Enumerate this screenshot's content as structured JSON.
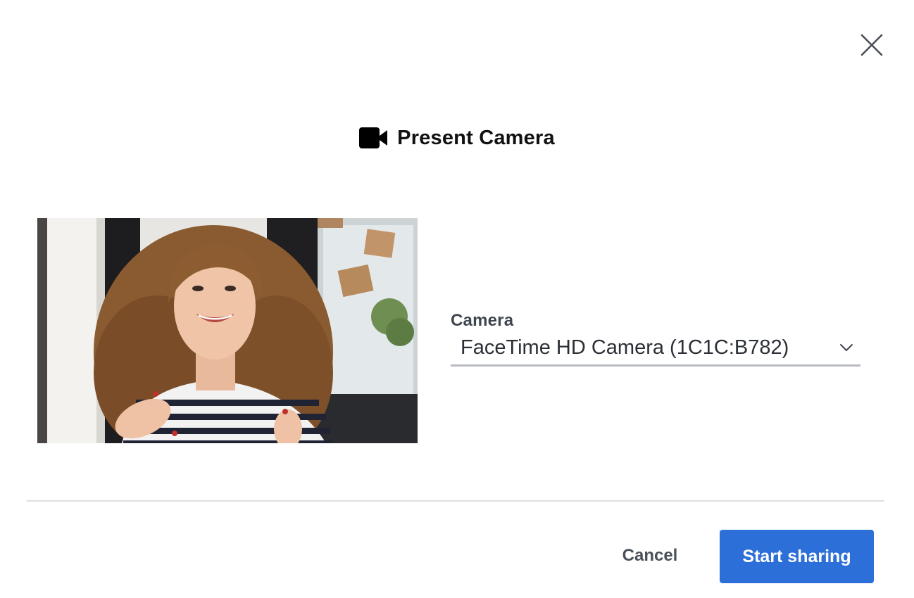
{
  "dialog": {
    "title": "Present Camera",
    "title_icon": "video-camera-icon",
    "close_icon": "close-icon",
    "preview_image": "camera-preview-woman-talking",
    "camera_field": {
      "label": "Camera",
      "selected_value": "FaceTime HD Camera (1C1C:B782)",
      "dropdown_icon": "chevron-down-icon"
    },
    "actions": {
      "cancel_label": "Cancel",
      "start_label": "Start sharing"
    }
  },
  "colors": {
    "primary_button": "#2c6fd8",
    "title_text": "#111111",
    "label_text": "#3f4650",
    "divider": "#dcdfe3",
    "select_underline": "#b8bcc2"
  }
}
